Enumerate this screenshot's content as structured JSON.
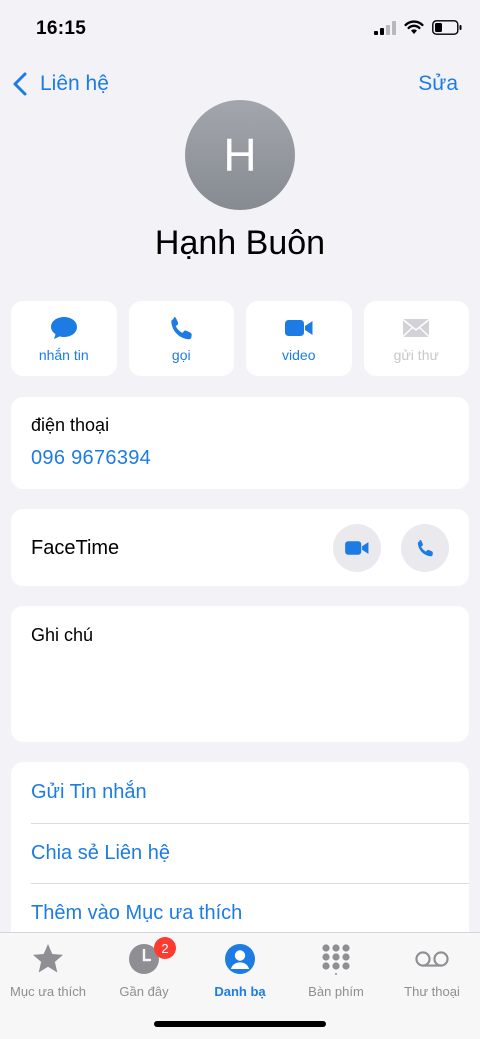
{
  "status_bar": {
    "time": "16:15"
  },
  "nav": {
    "back_label": "Liên hệ",
    "edit_label": "Sửa"
  },
  "contact": {
    "avatar_initial": "H",
    "name": "Hạnh Buôn"
  },
  "actions": [
    {
      "label": "nhắn tin",
      "icon": "message-icon",
      "enabled": true
    },
    {
      "label": "gọi",
      "icon": "phone-icon",
      "enabled": true
    },
    {
      "label": "video",
      "icon": "video-icon",
      "enabled": true
    },
    {
      "label": "gửi thư",
      "icon": "mail-icon",
      "enabled": false
    }
  ],
  "phone": {
    "label": "điện thoại",
    "number": "096 9676394"
  },
  "facetime": {
    "label": "FaceTime"
  },
  "notes": {
    "label": "Ghi chú"
  },
  "links": [
    {
      "label": "Gửi Tin nhắn"
    },
    {
      "label": "Chia sẻ Liên hệ"
    },
    {
      "label": "Thêm vào Mục ưa thích"
    }
  ],
  "tab_bar": {
    "tabs": [
      {
        "label": "Mục ưa thích",
        "icon": "star-icon"
      },
      {
        "label": "Gần đây",
        "icon": "clock-icon",
        "badge": "2"
      },
      {
        "label": "Danh bạ",
        "icon": "person-icon",
        "active": true
      },
      {
        "label": "Bàn phím",
        "icon": "keypad-icon"
      },
      {
        "label": "Thư thoại",
        "icon": "voicemail-icon"
      }
    ]
  },
  "colors": {
    "accent": "#1c7ce4",
    "background": "#f2f2f7",
    "badge": "#ff3b30"
  }
}
